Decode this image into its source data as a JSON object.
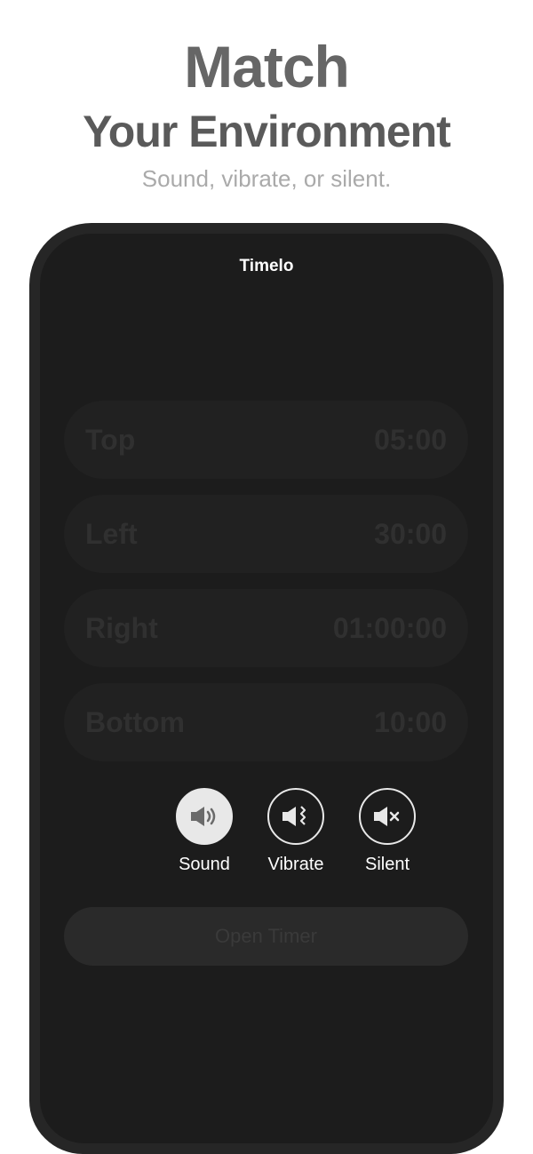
{
  "hero": {
    "title": "Match",
    "subtitle": "Your Environment",
    "tagline": "Sound, vibrate, or silent."
  },
  "app": {
    "title": "Timelo"
  },
  "timers": [
    {
      "label": "Top",
      "value": "05:00"
    },
    {
      "label": "Left",
      "value": "30:00"
    },
    {
      "label": "Right",
      "value": "01:00:00"
    },
    {
      "label": "Bottom",
      "value": "10:00"
    }
  ],
  "modes": [
    {
      "label": "Sound",
      "icon": "speaker-sound-icon",
      "active": true
    },
    {
      "label": "Vibrate",
      "icon": "speaker-vibrate-icon",
      "active": false
    },
    {
      "label": "Silent",
      "icon": "speaker-mute-icon",
      "active": false
    }
  ],
  "open_button": {
    "label": "Open Timer"
  },
  "colors": {
    "frame": "#262626",
    "screen": "#1c1c1c",
    "row": "#212121",
    "accent": "#e8e8e8"
  }
}
